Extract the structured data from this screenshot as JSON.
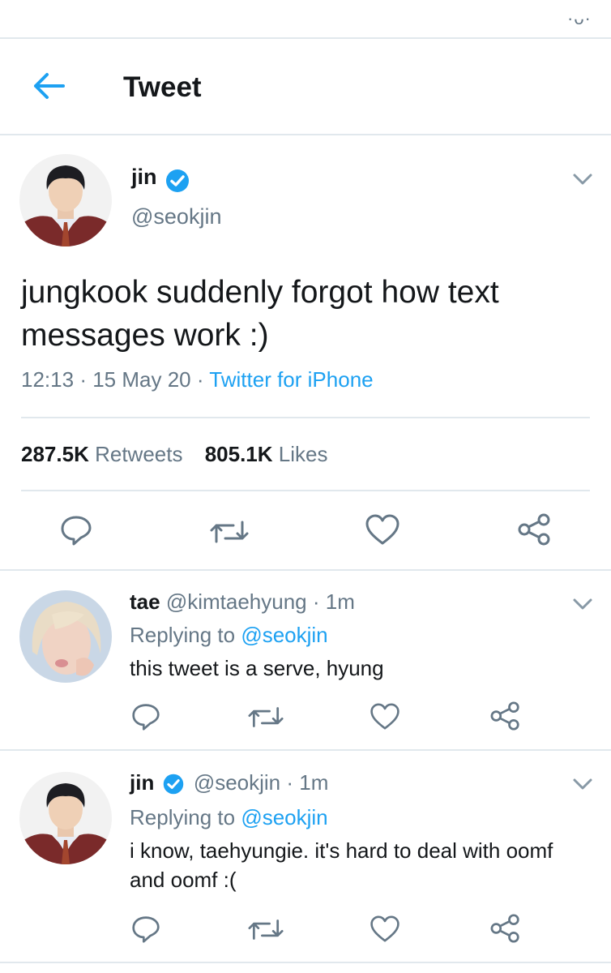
{
  "status_bar": {
    "indicator": "·ᴗ·"
  },
  "header": {
    "title": "Tweet"
  },
  "main_tweet": {
    "name": "jin",
    "handle": "@seokjin",
    "text": "jungkook suddenly forgot how text messages work :)",
    "time": "12:13",
    "date": "15 May 20",
    "dot": "·",
    "source": "Twitter for iPhone",
    "retweets_count": "287.5K",
    "retweets_label": "Retweets",
    "likes_count": "805.1K",
    "likes_label": "Likes"
  },
  "replies": [
    {
      "name": "tae",
      "handle": "@kimtaehyung",
      "time": "· 1m",
      "replying_label": "Replying to",
      "replying_to": "@seokjin",
      "text": "this tweet is a serve, hyung"
    },
    {
      "name": "jin",
      "handle": "@seokjin",
      "time": "· 1m",
      "replying_label": "Replying to",
      "replying_to": "@seokjin",
      "text_line1": "i know, taehyungie. it's hard to deal with oomf",
      "text_line2": "and oomf :("
    }
  ],
  "icons": [
    "back-arrow-icon",
    "verified-badge-icon",
    "chevron-down-icon",
    "reply-icon",
    "retweet-icon",
    "like-icon",
    "share-icon"
  ],
  "colors": {
    "accent": "#1da1f2",
    "text": "#14171a",
    "muted": "#657786",
    "divider": "#e1e8ed"
  }
}
